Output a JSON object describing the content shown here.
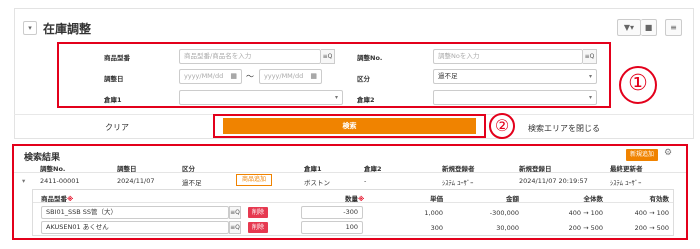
{
  "header": {
    "title": "在庫調整",
    "toggle_icon": "chevron-down-icon",
    "filter_icon": "filter-icon",
    "folder_icon": "folder-icon",
    "menu_icon": "hamburger-icon"
  },
  "search": {
    "product_code": {
      "label": "商品型番",
      "placeholder": "商品型番/商品名を入力"
    },
    "adjustment_no": {
      "label": "調整No.",
      "placeholder": "調整Noを入力"
    },
    "adjustment_date": {
      "label": "調整日",
      "from_placeholder": "yyyy/MM/dd",
      "to_placeholder": "yyyy/MM/dd",
      "range_sep": "〜"
    },
    "category": {
      "label": "区分",
      "value": "過不足"
    },
    "warehouse1": {
      "label": "倉庫1",
      "value": ""
    },
    "warehouse2": {
      "label": "倉庫2",
      "value": ""
    },
    "search_icon_text": "≡Q"
  },
  "actions": {
    "clear": "クリア",
    "search": "検索",
    "close_area": "検索エリアを閉じる"
  },
  "annotations": {
    "marker1": "①",
    "marker2": "②",
    "color": "#e3001b"
  },
  "results": {
    "title": "検索結果",
    "new_button": "新規追加",
    "columns": [
      "調整No.",
      "調整日",
      "区分",
      "倉庫1",
      "倉庫2",
      "新規登録者",
      "新規登録日",
      "最終更新者"
    ],
    "row": {
      "adj_no": "2411-00001",
      "date": "2024/11/07",
      "category": "過不足",
      "badge": "商品追加",
      "warehouse1": "ボストン",
      "warehouse2": "-",
      "created_by": "ｼｽﾃﾑ ﾕｰｻﾞｰ",
      "created_at": "2024/11/07 20:19:57",
      "updated_by": "ｼｽﾃﾑ ﾕｰｻﾞｰ"
    },
    "sub_columns": {
      "product": "商品型番",
      "quantity": "数量",
      "unit_price": "単価",
      "amount": "金額",
      "total": "全体数",
      "available": "有効数",
      "required_mark": "※"
    },
    "items": [
      {
        "product": "SBI01_SSB SS管（大）",
        "quantity": "-300",
        "unit_price": "1,000",
        "amount": "-300,000",
        "total": "400 → 100",
        "available": "400 → 100",
        "delete": "削除"
      },
      {
        "product": "AKUSEN01 あくせん",
        "quantity": "100",
        "unit_price": "300",
        "amount": "30,000",
        "total": "200 → 500",
        "available": "200 → 500",
        "delete": "削除"
      }
    ]
  },
  "colors": {
    "accent": "#f08300",
    "delete": "#e63950"
  }
}
